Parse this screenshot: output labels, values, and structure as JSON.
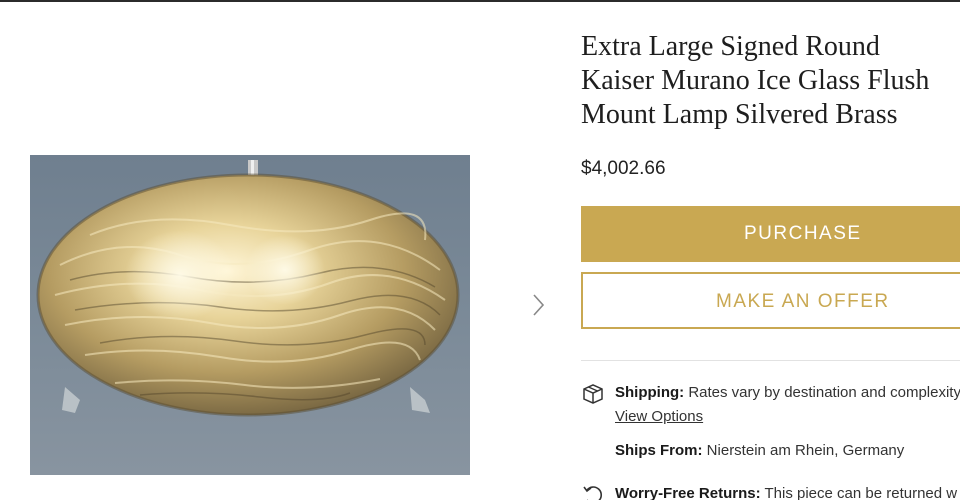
{
  "product": {
    "title_line1": "Extra Large Signed Round",
    "title_line2": "Kaiser Murano Ice Glass Flush",
    "title_line3": "Mount Lamp Silvered Brass",
    "price": "$4,002.66",
    "image_alt_icon": "lamp-photo"
  },
  "actions": {
    "purchase_label": "PURCHASE",
    "offer_label": "MAKE AN OFFER",
    "accent_color": "#c9a852"
  },
  "shipping": {
    "label": "Shipping:",
    "text": " Rates vary by destination and complexity",
    "view_options": "View Options",
    "ships_from_label": "Ships From:",
    "ships_from_value": " Nierstein am Rhein, Germany"
  },
  "returns": {
    "label": "Worry-Free Returns:",
    "text": " This piece can be returned w"
  },
  "icons": {
    "next": "chevron-right-icon",
    "shipping": "box-icon",
    "returns": "return-icon"
  }
}
